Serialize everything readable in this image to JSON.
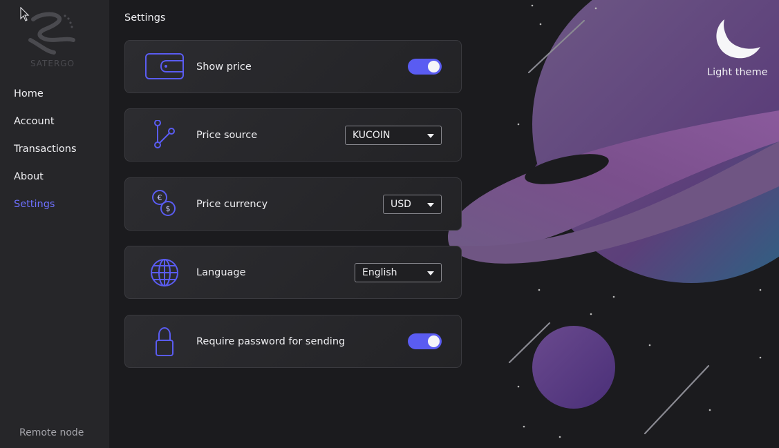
{
  "sidebar": {
    "logo_text": "SATERGO",
    "items": [
      {
        "label": "Home"
      },
      {
        "label": "Account"
      },
      {
        "label": "Transactions"
      },
      {
        "label": "About"
      },
      {
        "label": "Settings",
        "active": true
      }
    ],
    "footer": "Remote node"
  },
  "page": {
    "title": "Settings"
  },
  "settings": [
    {
      "label": "Show price",
      "icon": "wallet-icon",
      "control": "toggle",
      "on": true
    },
    {
      "label": "Price source",
      "icon": "branch-icon",
      "control": "select",
      "value": "KUCOIN"
    },
    {
      "label": "Price currency",
      "icon": "currency-icon",
      "control": "select",
      "value": "USD"
    },
    {
      "label": "Language",
      "icon": "globe-icon",
      "control": "select",
      "value": "English"
    },
    {
      "label": "Require password for sending",
      "icon": "lock-icon",
      "control": "toggle",
      "on": true
    }
  ],
  "theme": {
    "label": "Light theme",
    "icon": "moon-icon"
  },
  "colors": {
    "accent": "#5a5cf2",
    "active_nav": "#6e70ff",
    "background": "#1b1b1e",
    "sidebar": "#262629",
    "planet": "#6b4f7e"
  }
}
